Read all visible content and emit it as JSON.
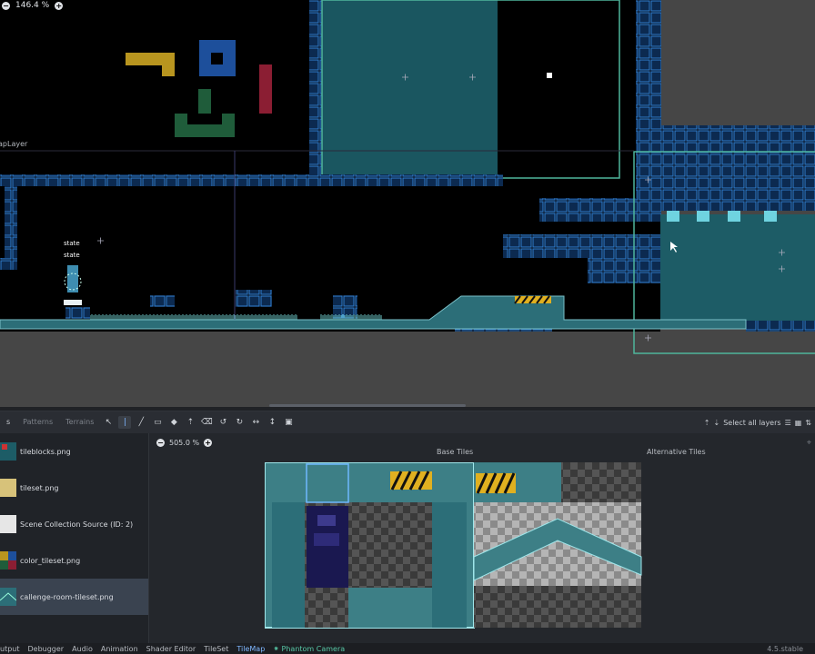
{
  "viewport": {
    "zoom": "146.4 %",
    "layer_label": "apLayer",
    "state_label_1": "state",
    "state_label_2": "state"
  },
  "tilemap_panel": {
    "tabs": [
      "s",
      "Patterns",
      "Terrains"
    ],
    "select_layers_label": "Select all layers",
    "atlas_zoom": "505.0 %",
    "base_tiles_header": "Base Tiles",
    "alt_tiles_header": "Alternative Tiles",
    "sources": [
      {
        "label": "tileblocks.png"
      },
      {
        "label": "tileset.png"
      },
      {
        "label": "Scene Collection Source (ID: 2)"
      },
      {
        "label": "color_tileset.png"
      },
      {
        "label": "callenge-room-tileset.png"
      }
    ]
  },
  "status_bar": {
    "output": "utput",
    "debugger": "Debugger",
    "audio": "Audio",
    "animation": "Animation",
    "shader_editor": "Shader Editor",
    "tileset": "TileSet",
    "tilemap": "TileMap",
    "phantom_camera": "Phantom Camera",
    "version": "4.5.stable"
  },
  "colors": {
    "tile_blue": "#1d5fa8",
    "teal_water": "#1d5c66",
    "accent": "#7fb7ff"
  }
}
